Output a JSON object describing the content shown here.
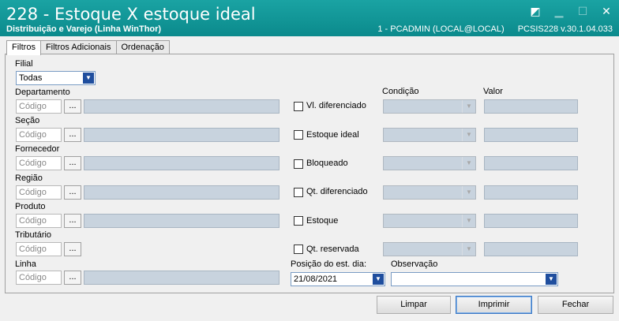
{
  "window": {
    "title": "228 - Estoque X estoque ideal",
    "subtitle": "Distribuição e Varejo (Linha WinThor)",
    "user_info": "1 - PCADMIN (LOCAL@LOCAL)",
    "version": "PCSIS228  v.30.1.04.033"
  },
  "tabs": [
    {
      "label": "Filtros",
      "active": true
    },
    {
      "label": "Filtros Adicionais",
      "active": false
    },
    {
      "label": "Ordenação",
      "active": false
    }
  ],
  "filial": {
    "label": "Filial",
    "value": "Todas"
  },
  "rows": [
    {
      "label": "Departamento",
      "placeholder": "Código",
      "dots": "..."
    },
    {
      "label": "Seção",
      "placeholder": "Código",
      "dots": "..."
    },
    {
      "label": "Fornecedor",
      "placeholder": "Código",
      "dots": "..."
    },
    {
      "label": "Região",
      "placeholder": "Código",
      "dots": "..."
    },
    {
      "label": "Produto",
      "placeholder": "Código",
      "dots": "..."
    },
    {
      "label": "Tributário",
      "placeholder": "Código",
      "dots": "..."
    },
    {
      "label": "Linha",
      "placeholder": "Código",
      "dots": "..."
    }
  ],
  "conditions": {
    "condicao_label": "Condição",
    "valor_label": "Valor",
    "checks": [
      {
        "label": "Vl. diferenciado"
      },
      {
        "label": "Estoque ideal"
      },
      {
        "label": "Bloqueado"
      },
      {
        "label": "Qt. diferenciado"
      },
      {
        "label": "Estoque"
      },
      {
        "label": "Qt. reservada"
      }
    ]
  },
  "posicao": {
    "label": "Posição do est. dia:",
    "value": "21/08/2021"
  },
  "observacao": {
    "label": "Observação",
    "value": ""
  },
  "buttons": {
    "limpar": "Limpar",
    "imprimir": "Imprimir",
    "fechar": "Fechar"
  }
}
